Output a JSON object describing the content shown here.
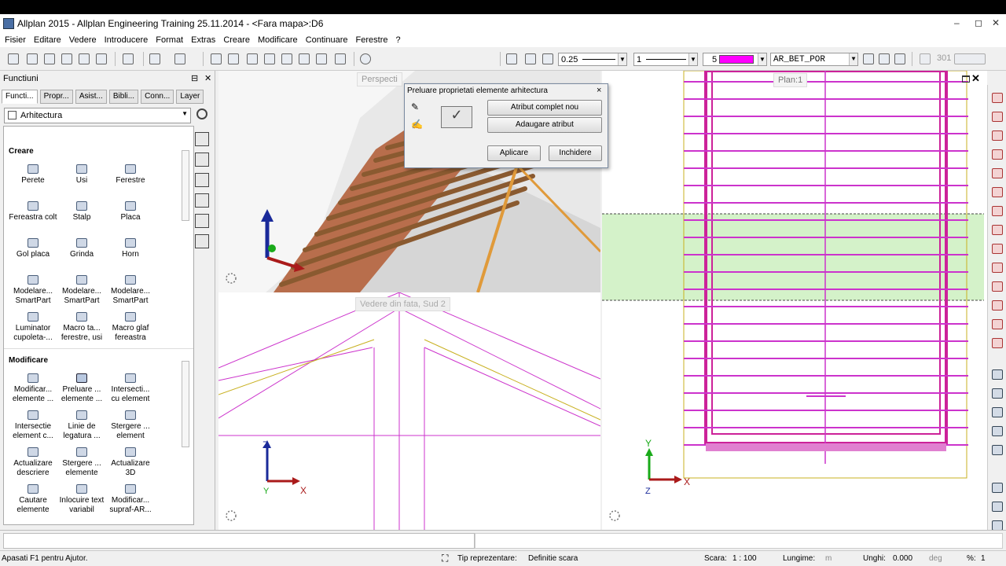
{
  "window": {
    "title": "Allplan 2015 - Allplan Engineering Training 25.11.2014 - <Fara mapa>:D6",
    "minimize": "–",
    "maximize": "◻",
    "close": "✕"
  },
  "menu": [
    "Fisier",
    "Editare",
    "Vedere",
    "Introducere",
    "Format",
    "Extras",
    "Creare",
    "Modificare",
    "Continuare",
    "Ferestre",
    "?"
  ],
  "toolbar": {
    "pen_value": "0.25",
    "line_value": "1",
    "color_value": "5",
    "color_swatch": "#ff00ff",
    "layer_value": "AR_BET_POR",
    "misc_value": "301"
  },
  "panel": {
    "title": "Functiuni",
    "pin": "⊟",
    "close": "✕",
    "tabs": [
      "Functi...",
      "Propr...",
      "Asist...",
      "Bibli...",
      "Conn...",
      "Layer"
    ],
    "category": "Arhitectura",
    "sections": [
      {
        "title": "Creare",
        "items": [
          "Perete",
          "Usi",
          "Ferestre",
          "Fereastra colt",
          "Stalp",
          "Placa",
          "Gol placa",
          "Grinda",
          "Horn",
          "Modelare... SmartPart",
          "Modelare... SmartPart",
          "Modelare... SmartPart",
          "Luminator cupoleta-...",
          "Macro ta... ferestre, usi",
          "Macro glaf fereastra"
        ]
      },
      {
        "title": "Modificare",
        "items": [
          "Modificar... elemente ...",
          "Preluare ... elemente ...",
          "Intersecti... cu element",
          "Intersectie element c...",
          "Linie de legatura ...",
          "Stergere ... element",
          "Actualizare descriere",
          "Stergere ... elemente",
          "Actualizare 3D",
          "Cautare elemente",
          "Inlocuire text variabil",
          "Modificar... supraf-AR..."
        ]
      }
    ]
  },
  "viewports": {
    "perspective_label": "Perspecti",
    "front_label": "Vedere din fata, Sud 2",
    "plan_label": "Plan:1"
  },
  "dialog": {
    "title": "Preluare proprietati elemente arhitectura",
    "close": "×",
    "btn_atribut": "Atribut complet nou",
    "btn_adaugare": "Adaugare atribut",
    "btn_aplicare": "Aplicare",
    "btn_inchidere": "Inchidere"
  },
  "axes": {
    "persp": {
      "z": "",
      "x": ""
    },
    "front": {
      "z": "Z",
      "x": "X",
      "y": "Y"
    },
    "plan": {
      "y": "Y",
      "x": "X",
      "z": "Z"
    }
  },
  "status": {
    "help": "Apasati F1 pentru Ajutor.",
    "tip_label": "Tip reprezentare:",
    "tip_value": "Definitie scara",
    "scara_label": "Scara:",
    "scara_value": "1 : 100",
    "lungime_label": "Lungime:",
    "lungime_unit": "m",
    "unghi_label": "Unghi:",
    "unghi_value": "0.000",
    "unghi_unit": "deg",
    "pct_label": "%:",
    "pct_value": "1"
  }
}
